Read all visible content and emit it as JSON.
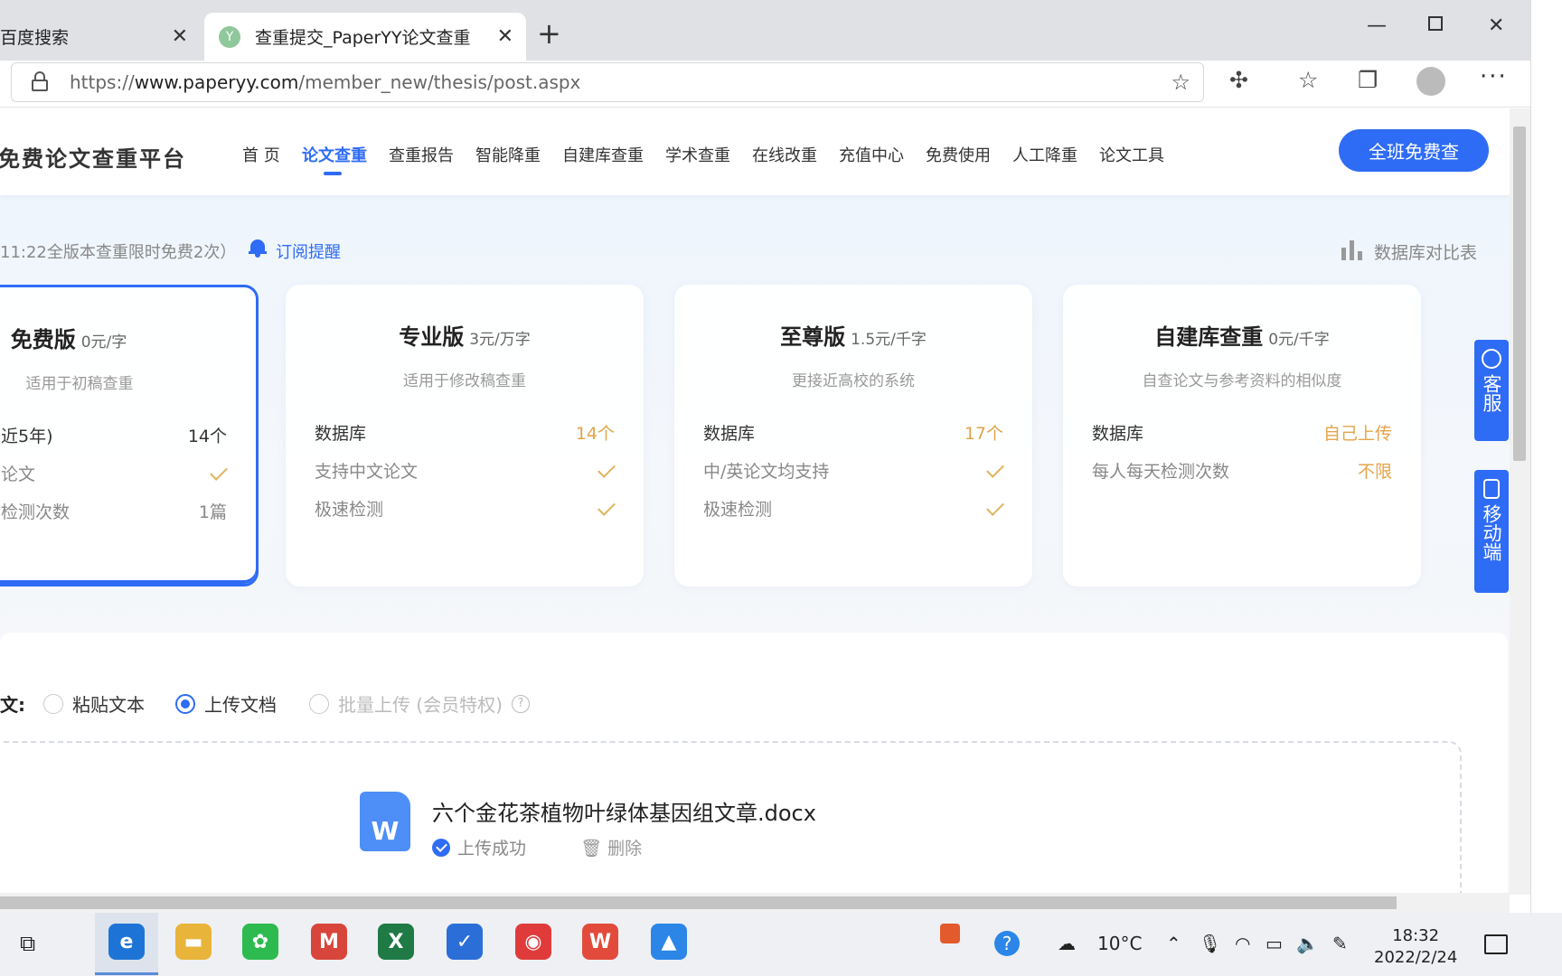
{
  "browser": {
    "tabs": [
      {
        "label": "百度搜索"
      },
      {
        "label": "查重提交_PaperYY论文查重",
        "favicon_glyph": "Y"
      }
    ],
    "new_tab_glyph": "+",
    "url_prefix": "https://",
    "url_domain": "www.paperyy.com",
    "url_path": "/member_new/thesis/post.aspx"
  },
  "site": {
    "brand": "免费论文查重平台",
    "nav": [
      "首 页",
      "论文查重",
      "查重报告",
      "智能降重",
      "自建库查重",
      "学术查重",
      "在线改重",
      "充值中心",
      "免费使用",
      "人工降重",
      "论文工具"
    ],
    "cta": "全班免费查",
    "notice": "11:22全版本查重限时免费2次）",
    "subscribe": "订阅提醒",
    "db_compare": "数据库对比表"
  },
  "cards": [
    {
      "title": "免费版",
      "price": "0元/字",
      "subtitle": "适用于初稿查重",
      "rows": [
        {
          "label": "近5年)",
          "value": "14个"
        },
        {
          "label": "论文",
          "value": "check"
        },
        {
          "label": "检测次数",
          "value": "1篇"
        }
      ]
    },
    {
      "title": "专业版",
      "price": "3元/万字",
      "subtitle": "适用于修改稿查重",
      "rows": [
        {
          "label": "数据库",
          "value": "14个"
        },
        {
          "label": "支持中文论文",
          "value": "check"
        },
        {
          "label": "极速检测",
          "value": "check"
        }
      ]
    },
    {
      "title": "至尊版",
      "price": "1.5元/千字",
      "subtitle": "更接近高校的系统",
      "rows": [
        {
          "label": "数据库",
          "value": "17个"
        },
        {
          "label": "中/英论文均支持",
          "value": "check"
        },
        {
          "label": "极速检测",
          "value": "check"
        }
      ]
    },
    {
      "title": "自建库查重",
      "price": "0元/千字",
      "subtitle": "自查论文与参考资料的相似度",
      "rows": [
        {
          "label": "数据库",
          "value": "自己上传"
        },
        {
          "label": "每人每天检测次数",
          "value": "不限"
        }
      ]
    }
  ],
  "side": {
    "service": "客服",
    "mobile": "移动端"
  },
  "upload": {
    "label": "文:",
    "options": [
      "粘贴文本",
      "上传文档",
      "批量上传 (会员特权)"
    ],
    "selected": "上传文档",
    "file_name": "六个金花茶植物叶绿体基因组文章.docx",
    "file_icon_letter": "W",
    "status": "上传成功",
    "delete": "删除"
  },
  "taskbar": {
    "temperature": "10°C",
    "time": "18:32",
    "date": "2022/2/24",
    "apps": [
      {
        "name": "edge",
        "glyph": "e",
        "color": "#1e74d6"
      },
      {
        "name": "explorer",
        "glyph": "▬",
        "color": "#e8b43a"
      },
      {
        "name": "wechat",
        "glyph": "✿",
        "color": "#2dbb4f"
      },
      {
        "name": "mail",
        "glyph": "M",
        "color": "#d8453a"
      },
      {
        "name": "excel",
        "glyph": "X",
        "color": "#1f7a45"
      },
      {
        "name": "security",
        "glyph": "✓",
        "color": "#2b6ed8"
      },
      {
        "name": "music",
        "glyph": "◉",
        "color": "#e03b3b"
      },
      {
        "name": "wps",
        "glyph": "W",
        "color": "#e24b3b"
      },
      {
        "name": "photos",
        "glyph": "▲",
        "color": "#2b86e8"
      }
    ]
  }
}
